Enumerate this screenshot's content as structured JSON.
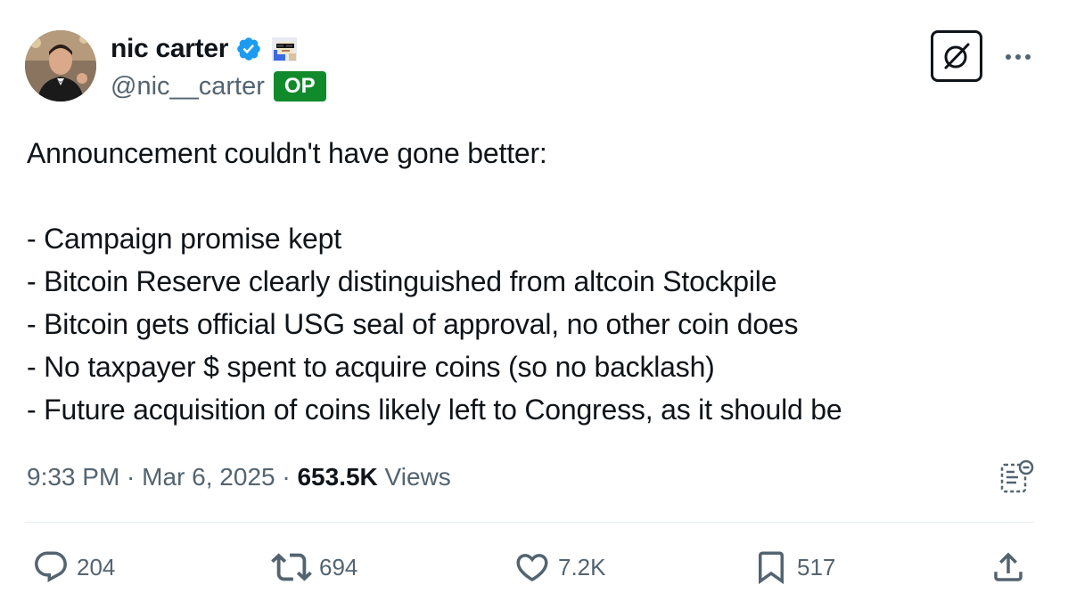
{
  "author": {
    "display_name": "nic carter",
    "handle": "@nic__carter",
    "badge": "OP",
    "verified_color": "#1d9bf0",
    "badge_color": "#118a2c"
  },
  "tweet": {
    "lines": [
      "Announcement couldn't have gone better:",
      "",
      "- Campaign promise kept",
      "- Bitcoin Reserve clearly distinguished from altcoin Stockpile",
      "- Bitcoin gets official USG seal of approval, no other coin does",
      "- No taxpayer $ spent to acquire coins (so no backlash)",
      "- Future acquisition of coins likely left to Congress, as it should be"
    ]
  },
  "meta": {
    "time": "9:33 PM",
    "separator": " · ",
    "date": "Mar 6, 2025",
    "views_count": "653.5K",
    "views_label": " Views"
  },
  "actions": {
    "replies": "204",
    "reposts": "694",
    "likes": "7.2K",
    "bookmarks": "517"
  },
  "icons": {
    "verified": "verified-badge-icon",
    "emoji": "cool-face-emoji-icon",
    "grok": "grok-icon",
    "more": "more-dots-icon",
    "notes": "community-notes-icon",
    "reply": "reply-icon",
    "retweet": "retweet-icon",
    "like": "heart-icon",
    "bookmark": "bookmark-icon",
    "share": "share-icon"
  }
}
